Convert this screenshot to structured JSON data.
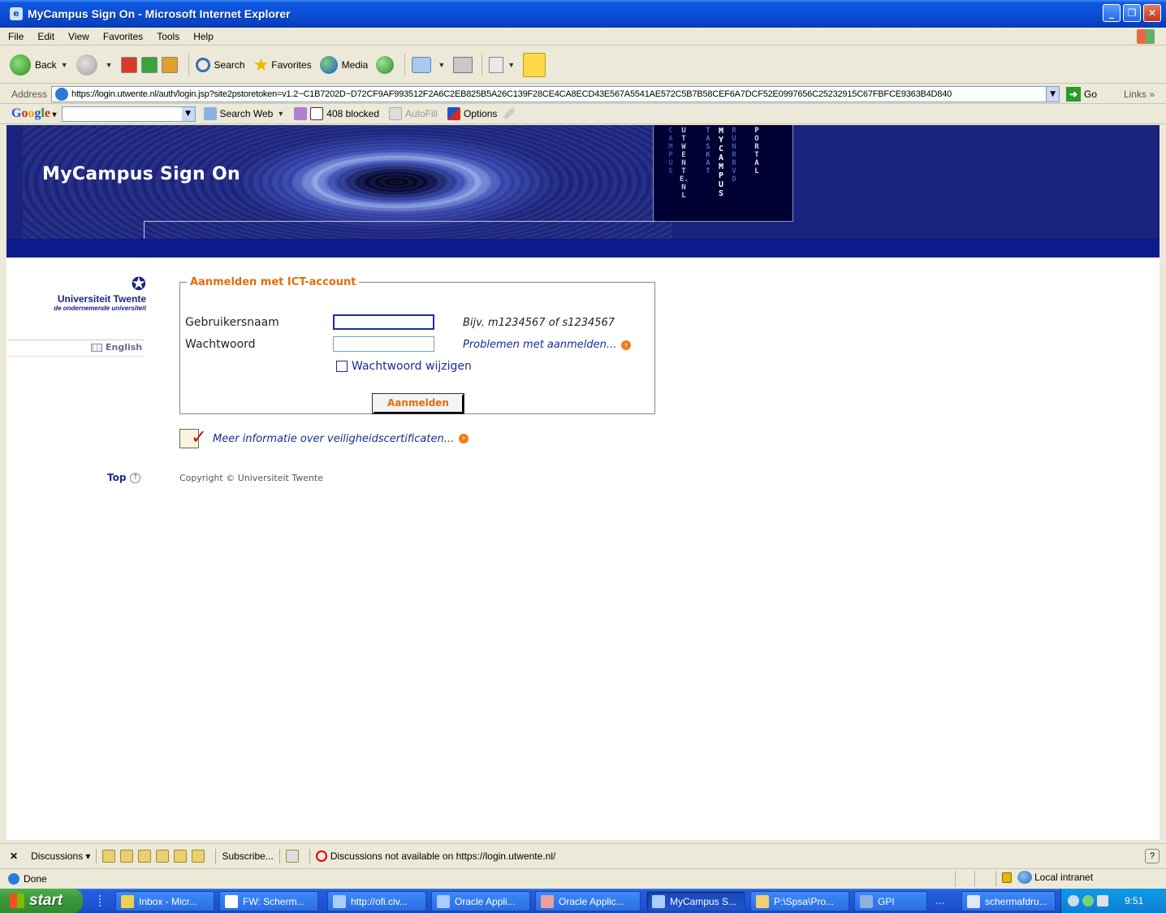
{
  "window": {
    "title": "MyCampus Sign On - Microsoft Internet Explorer",
    "min_label": "_",
    "max_label": "❐",
    "close_label": "✕"
  },
  "menu": [
    "File",
    "Edit",
    "View",
    "Favorites",
    "Tools",
    "Help"
  ],
  "toolbar": {
    "back_label": "Back",
    "search_label": "Search",
    "favorites_label": "Favorites",
    "media_label": "Media"
  },
  "address": {
    "label": "Address",
    "url": "https://login.utwente.nl/auth/login.jsp?site2pstoretoken=v1.2~C1B7202D~D72CF9AF993512F2A6C2EB825B5A26C139F28CE4CA8ECD43E567A5541AE572C5B7B58CEF6A7DCF52E0997656C25232915C67FBFCE9363B4D840",
    "go_label": "Go",
    "links_label": "Links"
  },
  "googlebar": {
    "search_web_label": "Search Web",
    "blocked_label": "408 blocked",
    "autofill_label": "AutoFill",
    "options_label": "Options"
  },
  "banner": {
    "title": "MyCampus Sign On",
    "tag_columns": [
      "CAMPUS",
      "UTWENTE.NL",
      "TASKAT",
      "MYCAMPUS",
      "RUNRRVD",
      "PORTAL"
    ]
  },
  "sidebar": {
    "logo_name": "Universiteit Twente",
    "logo_sub": "de ondernemende universiteit",
    "language_label": "English",
    "top_label": "Top"
  },
  "login": {
    "legend": "Aanmelden met ICT-account",
    "username_label": "Gebruikersnaam",
    "username_value": "",
    "username_hint": "Bijv. m1234567 of s1234567",
    "password_label": "Wachtwoord",
    "password_value": "",
    "problems_link": "Problemen met aanmelden...",
    "change_password_label": "Wachtwoord wijzigen",
    "submit_label": "Aanmelden"
  },
  "cert_link": "Meer informatie over veiligheidscertificaten...",
  "copyright": "Copyright © Universiteit Twente",
  "discussions": {
    "discussions_label": "Discussions",
    "subscribe_label": "Subscribe...",
    "message": "Discussions not available on https://login.utwente.nl/"
  },
  "status": {
    "text": "Done",
    "zone": "Local intranet"
  },
  "taskbar": {
    "start_label": "start",
    "tasks": [
      "Inbox - Micr...",
      "FW: Scherm...",
      "http://ofi.civ...",
      "Oracle Appli...",
      "Oracle Applic...",
      "MyCampus S...",
      "P:\\Spsa\\Pro...",
      "GPI",
      "schermafdru..."
    ],
    "overflow_label": "...",
    "clock": "9:51"
  }
}
